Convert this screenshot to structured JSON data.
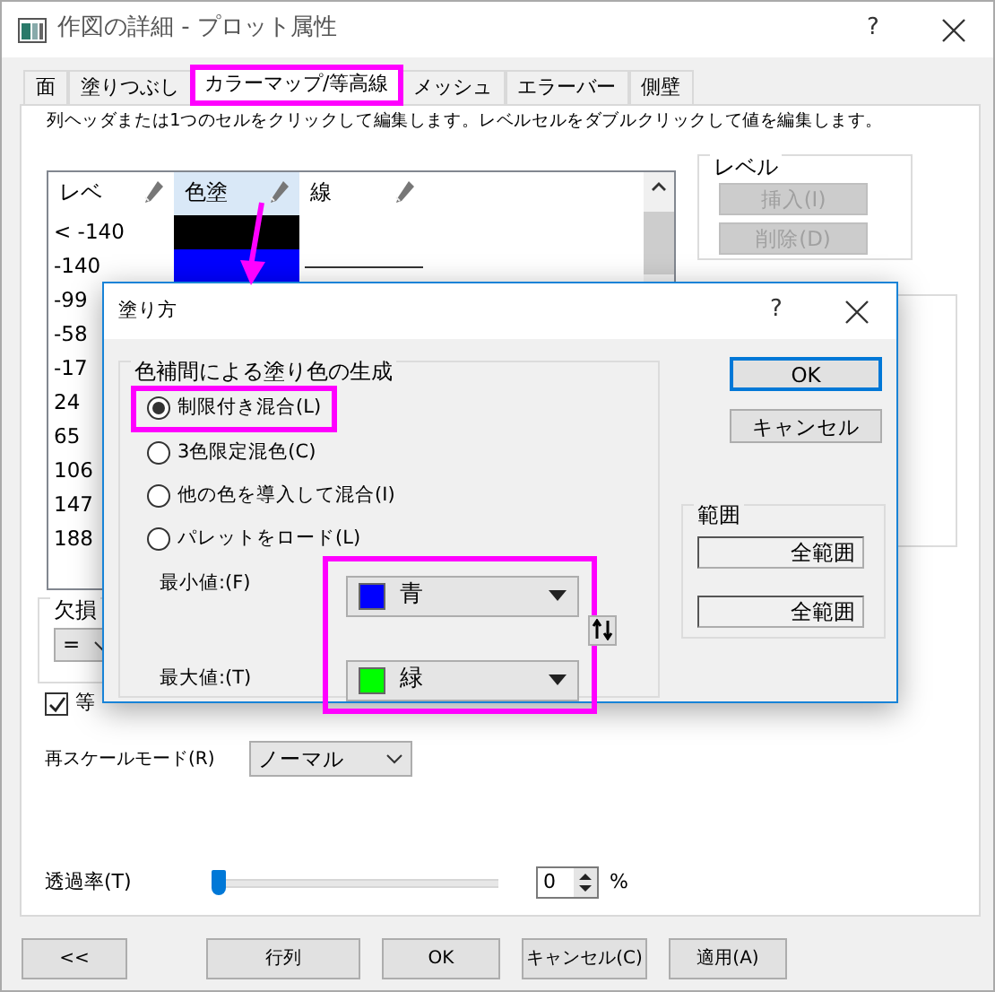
{
  "window": {
    "title": "作図の詳細 - プロット属性",
    "help_button": "?"
  },
  "tabs": [
    {
      "label": "面",
      "selected": false,
      "highlighted": false
    },
    {
      "label": "塗りつぶし",
      "selected": false,
      "highlighted": false
    },
    {
      "label": "カラーマップ/等高線",
      "selected": true,
      "highlighted": true
    },
    {
      "label": "メッシュ",
      "selected": false,
      "highlighted": false
    },
    {
      "label": "エラーバー",
      "selected": false,
      "highlighted": false
    },
    {
      "label": "側壁",
      "selected": false,
      "highlighted": false
    }
  ],
  "instruction": "列ヘッダまたは1つのセルをクリックして編集します。レベルセルをダブルクリックして値を編集します。",
  "level_table": {
    "columns": [
      {
        "label": "レベ",
        "selected": false
      },
      {
        "label": "色塗",
        "selected": true
      },
      {
        "label": "線",
        "selected": false
      }
    ],
    "rows": [
      {
        "level": "< -140",
        "color": "#000000",
        "line": false
      },
      {
        "level": "-140",
        "color": "#0000ff",
        "line": true
      },
      {
        "level": "-99"
      },
      {
        "level": "-58"
      },
      {
        "level": "-17"
      },
      {
        "level": "24"
      },
      {
        "level": "65"
      },
      {
        "level": "106"
      },
      {
        "level": "147"
      },
      {
        "level": "188"
      }
    ]
  },
  "level_group": {
    "title": "レベル",
    "buttons": [
      {
        "label": "挿入(I)",
        "disabled": true
      },
      {
        "label": "削除(D)",
        "disabled": true
      }
    ]
  },
  "missing_group": {
    "title": "欠損",
    "operator": "="
  },
  "contour_checkbox": {
    "label": "等",
    "checked": true
  },
  "rescale": {
    "label": "再スケールモード(R)",
    "value": "ノーマル"
  },
  "transparency": {
    "label": "透過率(T)",
    "level": 0,
    "value": "0",
    "unit": "%"
  },
  "buttons": [
    {
      "label": "<<"
    },
    {
      "label": "行列"
    },
    {
      "label": "OK"
    },
    {
      "label": "キャンセル(C)"
    },
    {
      "label": "適用(A)"
    }
  ],
  "fill_dialog": {
    "title": "塗り方",
    "help_button": "?",
    "group_title": "色補間による塗り色の生成",
    "options": [
      {
        "label": "制限付き混合(L)",
        "selected": true,
        "highlighted": true
      },
      {
        "label": "3色限定混色(C)",
        "selected": false,
        "highlighted": false
      },
      {
        "label": "他の色を導入して混合(I)",
        "selected": false,
        "highlighted": false
      },
      {
        "label": "パレットをロード(L)",
        "selected": false,
        "highlighted": false
      }
    ],
    "colors_highlighted": true,
    "min": {
      "label": "最小値:(F)",
      "color": "#0000ff",
      "value": "青"
    },
    "max": {
      "label": "最大値:(T)",
      "color": "#00ff00",
      "value": "緑"
    },
    "ok": "OK",
    "cancel": "キャンセル",
    "range": {
      "title": "範囲",
      "fields": [
        "全範囲",
        "全範囲"
      ]
    }
  }
}
